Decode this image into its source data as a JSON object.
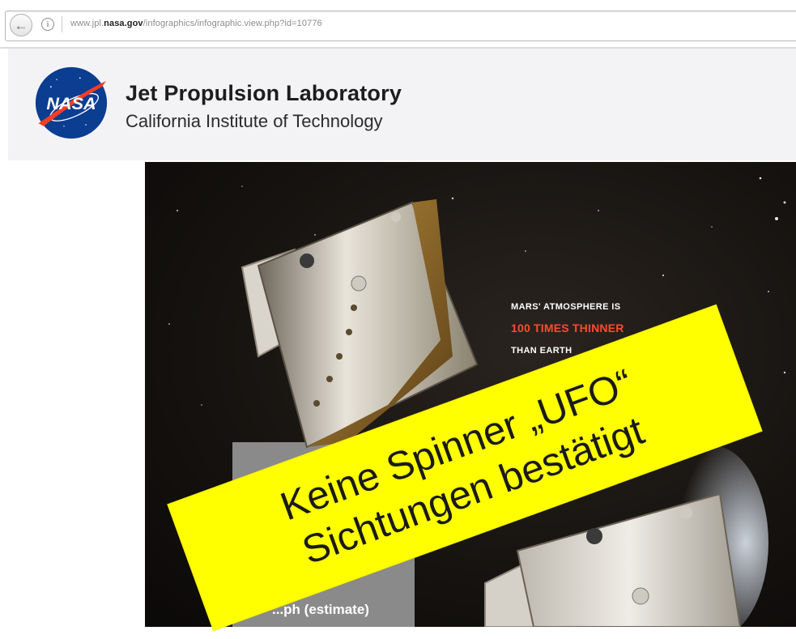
{
  "browser": {
    "url_prefix": "www.jpl.",
    "url_domain": "nasa.gov",
    "url_path": "/infographics/infographic.view.php?id=10776",
    "back_icon": "back-arrow-icon",
    "info_icon": "info-icon"
  },
  "header": {
    "logo_text": "NASA",
    "title": "Jet Propulsion Laboratory",
    "subtitle": "California Institute of Technology"
  },
  "infographic": {
    "line1": "MARS' ATMOSPHERE IS",
    "line2": "100 TIMES THINNER",
    "line3": "THAN EARTH",
    "estimate": "...ph (estimate)"
  },
  "banner": {
    "line1": "Keine Spinner „UFO“",
    "line2": "Sichtungen bestätigt",
    "color": "#ffff00"
  },
  "colors": {
    "accent_red": "#ff4a2e",
    "nasa_blue": "#0b3d91",
    "nasa_red": "#fc3d21"
  }
}
